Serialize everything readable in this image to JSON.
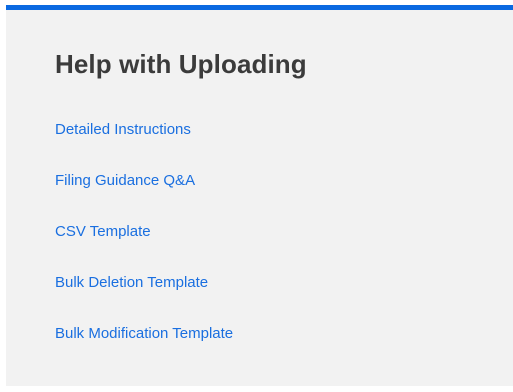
{
  "help_panel": {
    "accent_color": "#0b69e1",
    "title": "Help with Uploading",
    "links": [
      {
        "label": "Detailed Instructions"
      },
      {
        "label": "Filing Guidance Q&A"
      },
      {
        "label": "CSV Template"
      },
      {
        "label": "Bulk Deletion Template"
      },
      {
        "label": "Bulk Modification Template"
      }
    ]
  }
}
